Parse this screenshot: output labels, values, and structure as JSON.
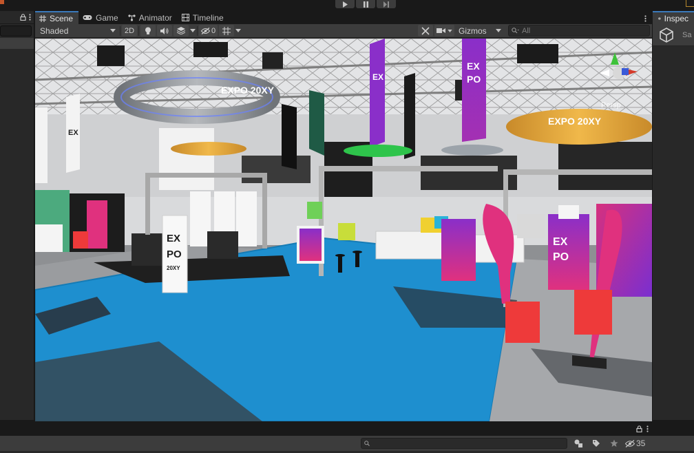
{
  "toolbar_top": {
    "play_icon": "play-icon",
    "pause_icon": "pause-icon",
    "step_icon": "step-icon"
  },
  "scene_tabs": [
    {
      "label": "Scene",
      "icon": "scene-grid-icon"
    },
    {
      "label": "Game",
      "icon": "gamepad-icon"
    },
    {
      "label": "Animator",
      "icon": "animator-icon"
    },
    {
      "label": "Timeline",
      "icon": "timeline-icon"
    }
  ],
  "scene_toolbar": {
    "draw_mode": "Shaded",
    "mode_2d": "2D",
    "hidden_count": "0",
    "gizmos": "Gizmos",
    "search_placeholder": "All"
  },
  "scene": {
    "perspective_label": "Persp",
    "ring_text_left": "EXPO 20XY",
    "ring_text_right": "EXPO 20XY",
    "banner_text_line1": "EX",
    "banner_text_line2": "PO",
    "banner_text_line3": "20XY"
  },
  "inspector": {
    "tab_label": "Inspec",
    "object_label": "Sa"
  },
  "bottom": {
    "hidden_count": "35"
  },
  "colors": {
    "accent_tab": "#3a79bb",
    "carpet_blue": "#1e8fcf",
    "banner_purple": "#8a2fc9",
    "banner_pink": "#e0317e",
    "cube_red": "#ee3a3a"
  }
}
